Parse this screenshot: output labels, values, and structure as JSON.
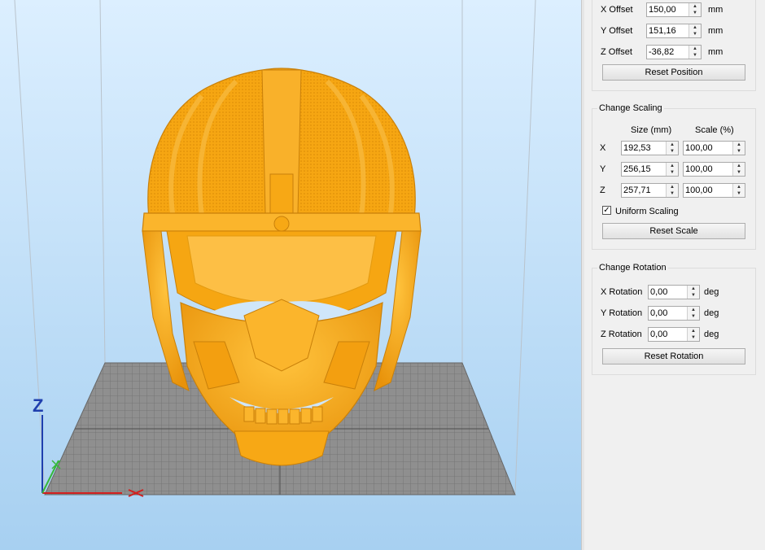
{
  "position": {
    "rows": [
      {
        "label": "X Offset",
        "value": "150,00",
        "unit": "mm"
      },
      {
        "label": "Y Offset",
        "value": "151,16",
        "unit": "mm"
      },
      {
        "label": "Z Offset",
        "value": "-36,82",
        "unit": "mm"
      }
    ],
    "reset_label": "Reset Position"
  },
  "scaling": {
    "title": "Change Scaling",
    "size_header": "Size (mm)",
    "scale_header": "Scale (%)",
    "rows": [
      {
        "axis": "X",
        "size": "192,53",
        "scale": "100,00"
      },
      {
        "axis": "Y",
        "size": "256,15",
        "scale": "100,00"
      },
      {
        "axis": "Z",
        "size": "257,71",
        "scale": "100,00"
      }
    ],
    "uniform_label": "Uniform Scaling",
    "uniform_checked": true,
    "reset_label": "Reset Scale"
  },
  "rotation": {
    "title": "Change Rotation",
    "rows": [
      {
        "label": "X Rotation",
        "value": "0,00",
        "unit": "deg"
      },
      {
        "label": "Y Rotation",
        "value": "0,00",
        "unit": "deg"
      },
      {
        "label": "Z Rotation",
        "value": "0,00",
        "unit": "deg"
      }
    ],
    "reset_label": "Reset Rotation"
  },
  "viewport": {
    "axis_z_label": "Z",
    "model_color": "#f7a815",
    "plate_color": "#8f8f8f",
    "background_top": "#d8ecfb",
    "background_bottom": "#a9d2f2"
  }
}
